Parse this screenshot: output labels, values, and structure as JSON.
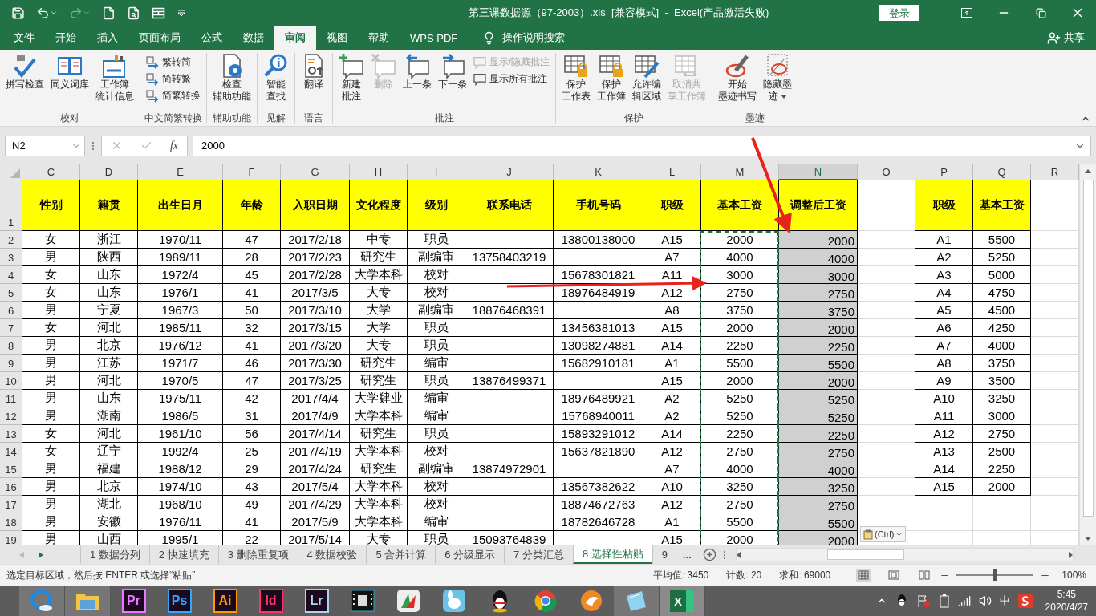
{
  "title_bar": {
    "title": "第三课数据源（97-2003）.xls  [兼容模式]  -  Excel(产品激活失败)",
    "login_button": "登录"
  },
  "ribbon_tabs": [
    {
      "label": "文件",
      "selected": false
    },
    {
      "label": "开始",
      "selected": false
    },
    {
      "label": "插入",
      "selected": false
    },
    {
      "label": "页面布局",
      "selected": false
    },
    {
      "label": "公式",
      "selected": false
    },
    {
      "label": "数据",
      "selected": false
    },
    {
      "label": "审阅",
      "selected": true
    },
    {
      "label": "视图",
      "selected": false
    },
    {
      "label": "帮助",
      "selected": false
    },
    {
      "label": "WPS PDF",
      "selected": false
    }
  ],
  "tell_me": "操作说明搜索",
  "share": "共享",
  "ribbon_groups": [
    {
      "name": "校对",
      "items": [
        {
          "kind": "large",
          "lines": [
            "拼写检查"
          ],
          "disabled": false
        },
        {
          "kind": "large",
          "lines": [
            "同义词库"
          ],
          "disabled": false
        },
        {
          "kind": "large",
          "lines": [
            "工作簿",
            "统计信息"
          ],
          "disabled": false
        }
      ]
    },
    {
      "name": "中文简繁转换",
      "items": [
        {
          "kind": "small",
          "lines": [
            "繁转简"
          ],
          "disabled": false
        },
        {
          "kind": "small",
          "lines": [
            "简转繁"
          ],
          "disabled": false
        },
        {
          "kind": "small",
          "lines": [
            "简繁转换"
          ],
          "disabled": false
        }
      ]
    },
    {
      "name": "辅助功能",
      "items": [
        {
          "kind": "large",
          "lines": [
            "检查",
            "辅助功能"
          ],
          "disabled": false
        }
      ]
    },
    {
      "name": "见解",
      "items": [
        {
          "kind": "large",
          "lines": [
            "智能",
            "查找"
          ],
          "disabled": false
        }
      ]
    },
    {
      "name": "语言",
      "items": [
        {
          "kind": "large",
          "lines": [
            "翻译"
          ],
          "disabled": false
        }
      ]
    },
    {
      "name": "批注",
      "items": [
        {
          "kind": "large",
          "lines": [
            "新建",
            "批注"
          ],
          "disabled": false
        },
        {
          "kind": "large",
          "lines": [
            "删除"
          ],
          "disabled": true
        },
        {
          "kind": "large",
          "lines": [
            "上一条"
          ],
          "disabled": false
        },
        {
          "kind": "large",
          "lines": [
            "下一条"
          ],
          "disabled": false
        },
        {
          "kind": "small",
          "lines": [
            "显示/隐藏批注"
          ],
          "disabled": true
        },
        {
          "kind": "small",
          "lines": [
            "显示所有批注"
          ],
          "disabled": false
        }
      ]
    },
    {
      "name": "保护",
      "items": [
        {
          "kind": "large",
          "lines": [
            "保护",
            "工作表"
          ],
          "disabled": false
        },
        {
          "kind": "large",
          "lines": [
            "保护",
            "工作簿"
          ],
          "disabled": false
        },
        {
          "kind": "large",
          "lines": [
            "允许编",
            "辑区域"
          ],
          "disabled": false
        },
        {
          "kind": "large",
          "lines": [
            "取消共",
            "享工作簿"
          ],
          "disabled": true
        }
      ]
    },
    {
      "name": "墨迹",
      "items": [
        {
          "kind": "large",
          "lines": [
            "开始",
            "墨迹书写"
          ],
          "disabled": false
        },
        {
          "kind": "dropdown",
          "lines": [
            "隐藏墨",
            "迹"
          ],
          "disabled": false
        }
      ]
    }
  ],
  "formula_bar": {
    "name_box": "N2",
    "fx": "fx",
    "value": "2000"
  },
  "columns": [
    {
      "letter": "C",
      "selected": false,
      "copied": false
    },
    {
      "letter": "D",
      "selected": false,
      "copied": false
    },
    {
      "letter": "E",
      "selected": false,
      "copied": false
    },
    {
      "letter": "F",
      "selected": false,
      "copied": false
    },
    {
      "letter": "G",
      "selected": false,
      "copied": false
    },
    {
      "letter": "H",
      "selected": false,
      "copied": false
    },
    {
      "letter": "I",
      "selected": false,
      "copied": false
    },
    {
      "letter": "J",
      "selected": false,
      "copied": false
    },
    {
      "letter": "K",
      "selected": false,
      "copied": false
    },
    {
      "letter": "L",
      "selected": false,
      "copied": false
    },
    {
      "letter": "M",
      "selected": false,
      "copied": true
    },
    {
      "letter": "N",
      "selected": true,
      "copied": false
    },
    {
      "letter": "O",
      "selected": false,
      "copied": false
    },
    {
      "letter": "P",
      "selected": false,
      "copied": false
    },
    {
      "letter": "Q",
      "selected": false,
      "copied": false
    },
    {
      "letter": "R",
      "selected": false,
      "copied": false
    }
  ],
  "rows": [
    {
      "number": "1",
      "kind": "header",
      "cells": [
        "性别",
        "籍贯",
        "出生日月",
        "年龄",
        "入职日期",
        "文化程度",
        "级别",
        "联系电话",
        "手机号码",
        "职级",
        "基本工资",
        "调整后工资",
        null,
        "职级",
        "基本工资",
        null
      ]
    },
    {
      "number": "2",
      "kind": "data",
      "cells": [
        "女",
        "浙江",
        "1970/11",
        "47",
        "2017/2/18",
        "中专",
        "职员",
        null,
        "13800138000",
        "A15",
        "2000",
        "2000",
        null,
        "A1",
        "5500",
        null
      ]
    },
    {
      "number": "3",
      "kind": "data",
      "cells": [
        "男",
        "陕西",
        "1989/11",
        "28",
        "2017/2/23",
        "研究生",
        "副编审",
        "13758403219",
        null,
        "A7",
        "4000",
        "4000",
        null,
        "A2",
        "5250",
        null
      ]
    },
    {
      "number": "4",
      "kind": "data",
      "cells": [
        "女",
        "山东",
        "1972/4",
        "45",
        "2017/2/28",
        "大学本科",
        "校对",
        null,
        "15678301821",
        "A11",
        "3000",
        "3000",
        null,
        "A3",
        "5000",
        null
      ]
    },
    {
      "number": "5",
      "kind": "data",
      "cells": [
        "女",
        "山东",
        "1976/1",
        "41",
        "2017/3/5",
        "大专",
        "校对",
        null,
        "18976484919",
        "A12",
        "2750",
        "2750",
        null,
        "A4",
        "4750",
        null
      ]
    },
    {
      "number": "6",
      "kind": "data",
      "cells": [
        "男",
        "宁夏",
        "1967/3",
        "50",
        "2017/3/10",
        "大学",
        "副编审",
        "18876468391",
        null,
        "A8",
        "3750",
        "3750",
        null,
        "A5",
        "4500",
        null
      ]
    },
    {
      "number": "7",
      "kind": "data",
      "cells": [
        "女",
        "河北",
        "1985/11",
        "32",
        "2017/3/15",
        "大学",
        "职员",
        null,
        "13456381013",
        "A15",
        "2000",
        "2000",
        null,
        "A6",
        "4250",
        null
      ]
    },
    {
      "number": "8",
      "kind": "data",
      "cells": [
        "男",
        "北京",
        "1976/12",
        "41",
        "2017/3/20",
        "大专",
        "职员",
        null,
        "13098274881",
        "A14",
        "2250",
        "2250",
        null,
        "A7",
        "4000",
        null
      ]
    },
    {
      "number": "9",
      "kind": "data",
      "cells": [
        "男",
        "江苏",
        "1971/7",
        "46",
        "2017/3/30",
        "研究生",
        "编审",
        null,
        "15682910181",
        "A1",
        "5500",
        "5500",
        null,
        "A8",
        "3750",
        null
      ]
    },
    {
      "number": "10",
      "kind": "data",
      "cells": [
        "男",
        "河北",
        "1970/5",
        "47",
        "2017/3/25",
        "研究生",
        "职员",
        "13876499371",
        null,
        "A15",
        "2000",
        "2000",
        null,
        "A9",
        "3500",
        null
      ]
    },
    {
      "number": "11",
      "kind": "data",
      "cells": [
        "男",
        "山东",
        "1975/11",
        "42",
        "2017/4/4",
        "大学肄业",
        "编审",
        null,
        "18976489921",
        "A2",
        "5250",
        "5250",
        null,
        "A10",
        "3250",
        null
      ]
    },
    {
      "number": "12",
      "kind": "data",
      "cells": [
        "男",
        "湖南",
        "1986/5",
        "31",
        "2017/4/9",
        "大学本科",
        "编审",
        null,
        "15768940011",
        "A2",
        "5250",
        "5250",
        null,
        "A11",
        "3000",
        null
      ]
    },
    {
      "number": "13",
      "kind": "data",
      "cells": [
        "女",
        "河北",
        "1961/10",
        "56",
        "2017/4/14",
        "研究生",
        "职员",
        null,
        "15893291012",
        "A14",
        "2250",
        "2250",
        null,
        "A12",
        "2750",
        null
      ]
    },
    {
      "number": "14",
      "kind": "data",
      "cells": [
        "女",
        "辽宁",
        "1992/4",
        "25",
        "2017/4/19",
        "大学本科",
        "校对",
        null,
        "15637821890",
        "A12",
        "2750",
        "2750",
        null,
        "A13",
        "2500",
        null
      ]
    },
    {
      "number": "15",
      "kind": "data",
      "cells": [
        "男",
        "福建",
        "1988/12",
        "29",
        "2017/4/24",
        "研究生",
        "副编审",
        "13874972901",
        null,
        "A7",
        "4000",
        "4000",
        null,
        "A14",
        "2250",
        null
      ]
    },
    {
      "number": "16",
      "kind": "data",
      "cells": [
        "男",
        "北京",
        "1974/10",
        "43",
        "2017/5/4",
        "大学本科",
        "校对",
        null,
        "13567382622",
        "A10",
        "3250",
        "3250",
        null,
        "A15",
        "2000",
        null
      ]
    },
    {
      "number": "17",
      "kind": "data",
      "cells": [
        "男",
        "湖北",
        "1968/10",
        "49",
        "2017/4/29",
        "大学本科",
        "校对",
        null,
        "18874672763",
        "A12",
        "2750",
        "2750",
        null,
        null,
        null,
        null
      ]
    },
    {
      "number": "18",
      "kind": "data",
      "cells": [
        "男",
        "安徽",
        "1976/11",
        "41",
        "2017/5/9",
        "大学本科",
        "编审",
        null,
        "18782646728",
        "A1",
        "5500",
        "5500",
        null,
        null,
        null,
        null
      ]
    },
    {
      "number": "19",
      "kind": "data",
      "cells": [
        "男",
        "山西",
        "1995/1",
        "22",
        "2017/5/14",
        "大专",
        "职员",
        "15093764839",
        null,
        "A15",
        "2000",
        "2000",
        null,
        null,
        null,
        null
      ]
    }
  ],
  "paste_options": "(Ctrl)",
  "sheet_tabs": [
    {
      "label": "1 数据分列",
      "selected": false
    },
    {
      "label": "2 快速填充",
      "selected": false
    },
    {
      "label": "3 删除重复项",
      "selected": false
    },
    {
      "label": "4 数据校验",
      "selected": false
    },
    {
      "label": "5 合并计算",
      "selected": false
    },
    {
      "label": "6 分级显示",
      "selected": false
    },
    {
      "label": "7 分类汇总",
      "selected": false
    },
    {
      "label": "8 选择性粘贴",
      "selected": true
    },
    {
      "label": "9",
      "selected": false
    }
  ],
  "more_tabs": "...",
  "status_bar": {
    "message": "选定目标区域，然后按 ENTER 或选择“粘贴”",
    "stats": [
      "平均值: 3450",
      "计数: 20",
      "求和: 69000"
    ],
    "zoom": {
      "level": 0.5,
      "reading": "100%"
    }
  },
  "taskbar": {
    "apps": [
      {
        "kind": "browser",
        "running": true,
        "selected": false
      },
      {
        "kind": "folder",
        "running": true,
        "selected": false
      },
      {
        "kind": "adobe",
        "label": "Pr",
        "color": "#ea77ff",
        "running": false,
        "selected": false
      },
      {
        "kind": "adobe",
        "label": "Ps",
        "color": "#31a8ff",
        "running": false,
        "selected": false
      },
      {
        "kind": "adobe",
        "label": "Ai",
        "color": "#ff9a00",
        "running": false,
        "selected": false
      },
      {
        "kind": "adobe",
        "label": "Id",
        "color": "#ff3366",
        "running": false,
        "selected": false
      },
      {
        "kind": "adobe",
        "label": "Lr",
        "color": "#add5ec",
        "running": false,
        "selected": false
      },
      {
        "kind": "film",
        "running": false,
        "selected": false
      },
      {
        "kind": "chart",
        "running": false,
        "selected": false
      },
      {
        "kind": "cartoon",
        "running": false,
        "selected": false
      },
      {
        "kind": "penguin",
        "running": false,
        "selected": false
      },
      {
        "kind": "globe",
        "running": false,
        "selected": false
      },
      {
        "kind": "fox",
        "running": false,
        "selected": false
      },
      {
        "kind": "notepad",
        "running": true,
        "selected": false
      },
      {
        "kind": "sheet",
        "label": "X",
        "running": true,
        "selected": true
      }
    ],
    "ime": "中",
    "time": "5:45",
    "date": "2020/4/27"
  }
}
